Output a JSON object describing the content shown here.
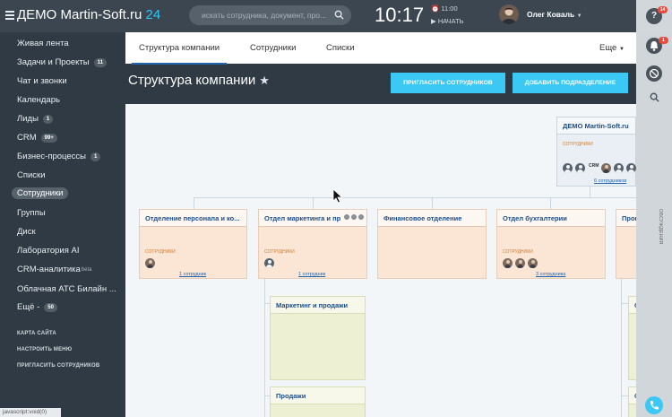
{
  "header": {
    "logo_text": "ДЕМО Martin-Soft.ru",
    "logo_num": "24",
    "search_placeholder": "искать сотрудника, документ, про...",
    "time": "10:17",
    "alarm": "⏰ 11:00",
    "start_label": "▶ НАЧАТЬ",
    "user_name": "Олег Коваль"
  },
  "sidebar": {
    "items": [
      {
        "label": "Живая лента"
      },
      {
        "label": "Задачи и Проекты",
        "badge": "11"
      },
      {
        "label": "Чат и звонки"
      },
      {
        "label": "Календарь"
      },
      {
        "label": "Лиды",
        "badge": "1"
      },
      {
        "label": "CRM",
        "badge": "99+"
      },
      {
        "label": "Бизнес-процессы",
        "badge": "1"
      },
      {
        "label": "Списки"
      },
      {
        "label": "Сотрудники",
        "active": true
      },
      {
        "label": "Группы"
      },
      {
        "label": "Диск"
      },
      {
        "label": "Лаборатория AI"
      },
      {
        "label": "CRM-аналитика",
        "sup": "beta"
      },
      {
        "label": "Облачная АТС Билайн ..."
      },
      {
        "label": "Ещё -",
        "badge": "50"
      }
    ],
    "links": [
      "КАРТА САЙТА",
      "НАСТРОИТЬ МЕНЮ",
      "ПРИГЛАСИТЬ СОТРУДНИКОВ"
    ],
    "status_text": "javascript:void(0)"
  },
  "tabs": [
    {
      "label": "Структура компании",
      "active": true
    },
    {
      "label": "Сотрудники"
    },
    {
      "label": "Списки"
    }
  ],
  "more_label": "Еще",
  "page": {
    "title": "Структура компании",
    "star": "★",
    "invite_button": "ПРИГЛАСИТЬ СОТРУДНИКОВ",
    "add_dept_button": "ДОБАВИТЬ ПОДРАЗДЕЛЕНИЕ"
  },
  "org": {
    "root": {
      "name": "ДЕМО Martin-Soft.ru",
      "role": "СОТРУДНИКИ",
      "crm_label": "CRM",
      "count": "6 сотрудников"
    },
    "depts": [
      {
        "name": "Отделение персонала и ко...",
        "role": "СОТРУДНИКИ",
        "count": "1 сотрудник"
      },
      {
        "name": "Отдел маркетинга и пр",
        "role": "СОТРУДНИКИ",
        "count": "1 сотрудник"
      },
      {
        "name": "Финансовое отделение"
      },
      {
        "name": "Отдел бухгалтерии",
        "role": "СОТРУДНИКИ",
        "count": "3 сотрудника"
      },
      {
        "name": "Производств"
      }
    ],
    "subdepts": [
      {
        "name": "Маркетинг и продажи"
      },
      {
        "name": "Продажи"
      },
      {
        "name": "Отдел внеш"
      },
      {
        "name": "Отдел гр"
      }
    ]
  },
  "right_panel": {
    "notif_badge": "14",
    "bell_badge": "1",
    "vertical_text": "ОБСУЖДЕНИЯ"
  },
  "colors": {
    "accent": "#3bc8f5",
    "sidebar_bg": "#2f3a44",
    "dept_bg": "#fbe6d6",
    "subdept_bg": "#eef0d4",
    "link": "#2067b0"
  }
}
